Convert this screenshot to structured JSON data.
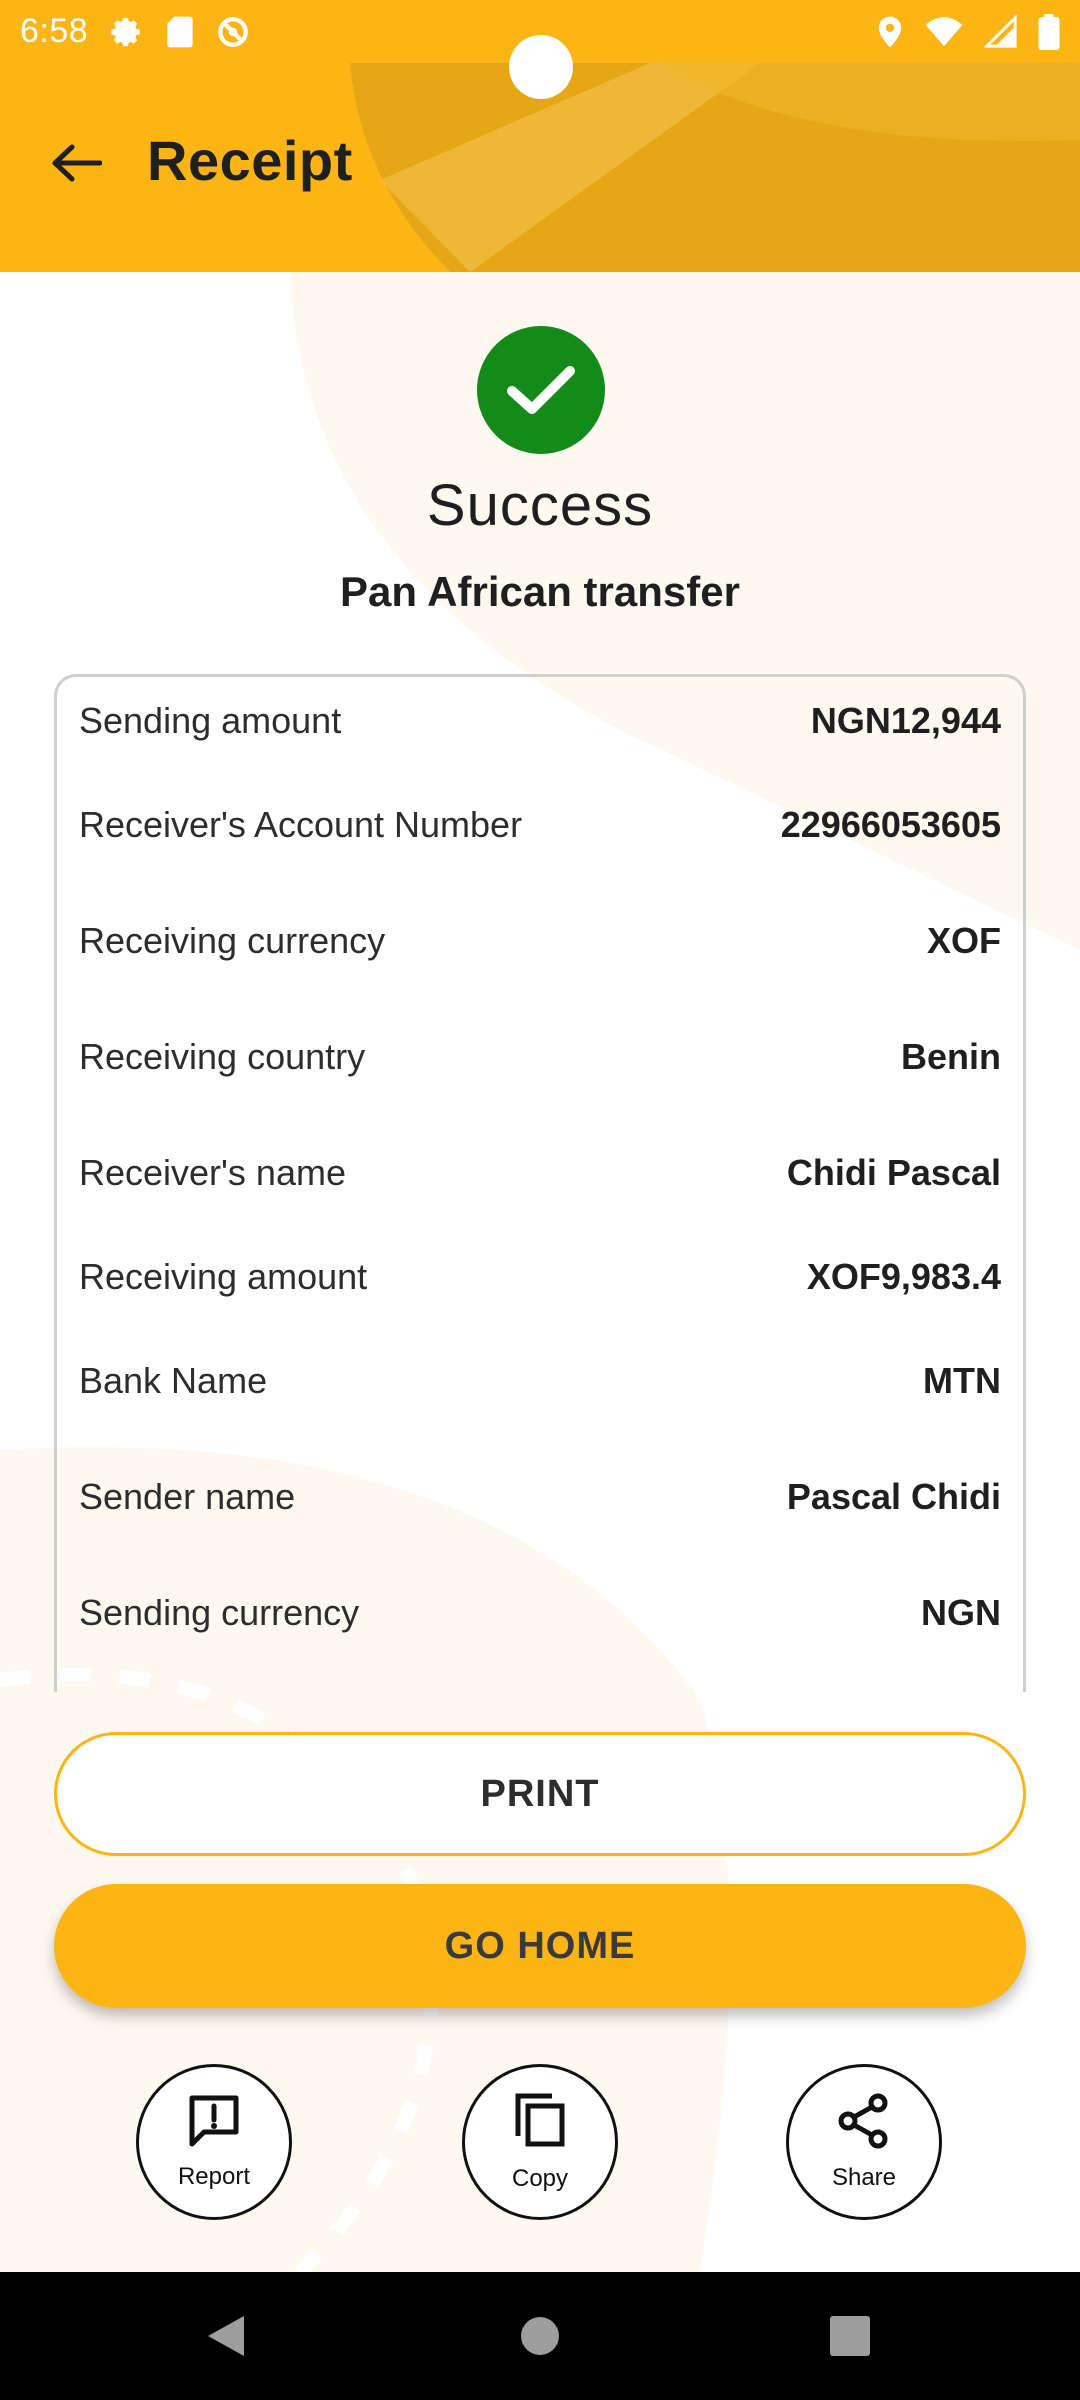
{
  "colors": {
    "accent": "#fdb515",
    "success": "#138a1a",
    "text": "#1f1f1f"
  },
  "status_bar": {
    "time": "6:58",
    "left_icons": [
      "settings-icon",
      "sd-card-icon",
      "no-sync-icon"
    ],
    "right_icons": [
      "location-icon",
      "wifi-icon",
      "signal-icon",
      "battery-icon"
    ]
  },
  "app_bar": {
    "back_icon": "arrow-left-icon",
    "title": "Receipt"
  },
  "header": {
    "status_icon": "check-circle-icon",
    "status_text": "Success",
    "transfer_type": "Pan African transfer"
  },
  "details": [
    {
      "label": "Sending amount",
      "value": "NGN12,944"
    },
    {
      "label": "Receiver's Account Number",
      "value": "22966053605"
    },
    {
      "label": "Receiving currency",
      "value": "XOF"
    },
    {
      "label": "Receiving country",
      "value": "Benin"
    },
    {
      "label": "Receiver's name",
      "value": "Chidi Pascal"
    },
    {
      "label": "Receiving amount",
      "value": "XOF9,983.4"
    },
    {
      "label": "Bank Name",
      "value": "MTN"
    },
    {
      "label": "Sender name",
      "value": "Pascal Chidi"
    },
    {
      "label": "Sending currency",
      "value": "NGN"
    }
  ],
  "buttons": {
    "print": "PRINT",
    "go_home": "GO HOME"
  },
  "actions": [
    {
      "label": "Report",
      "icon": "report-icon"
    },
    {
      "label": "Copy",
      "icon": "copy-icon"
    },
    {
      "label": "Share",
      "icon": "share-icon"
    }
  ],
  "nav_bar": [
    "back-nav-icon",
    "home-nav-icon",
    "recents-nav-icon"
  ]
}
